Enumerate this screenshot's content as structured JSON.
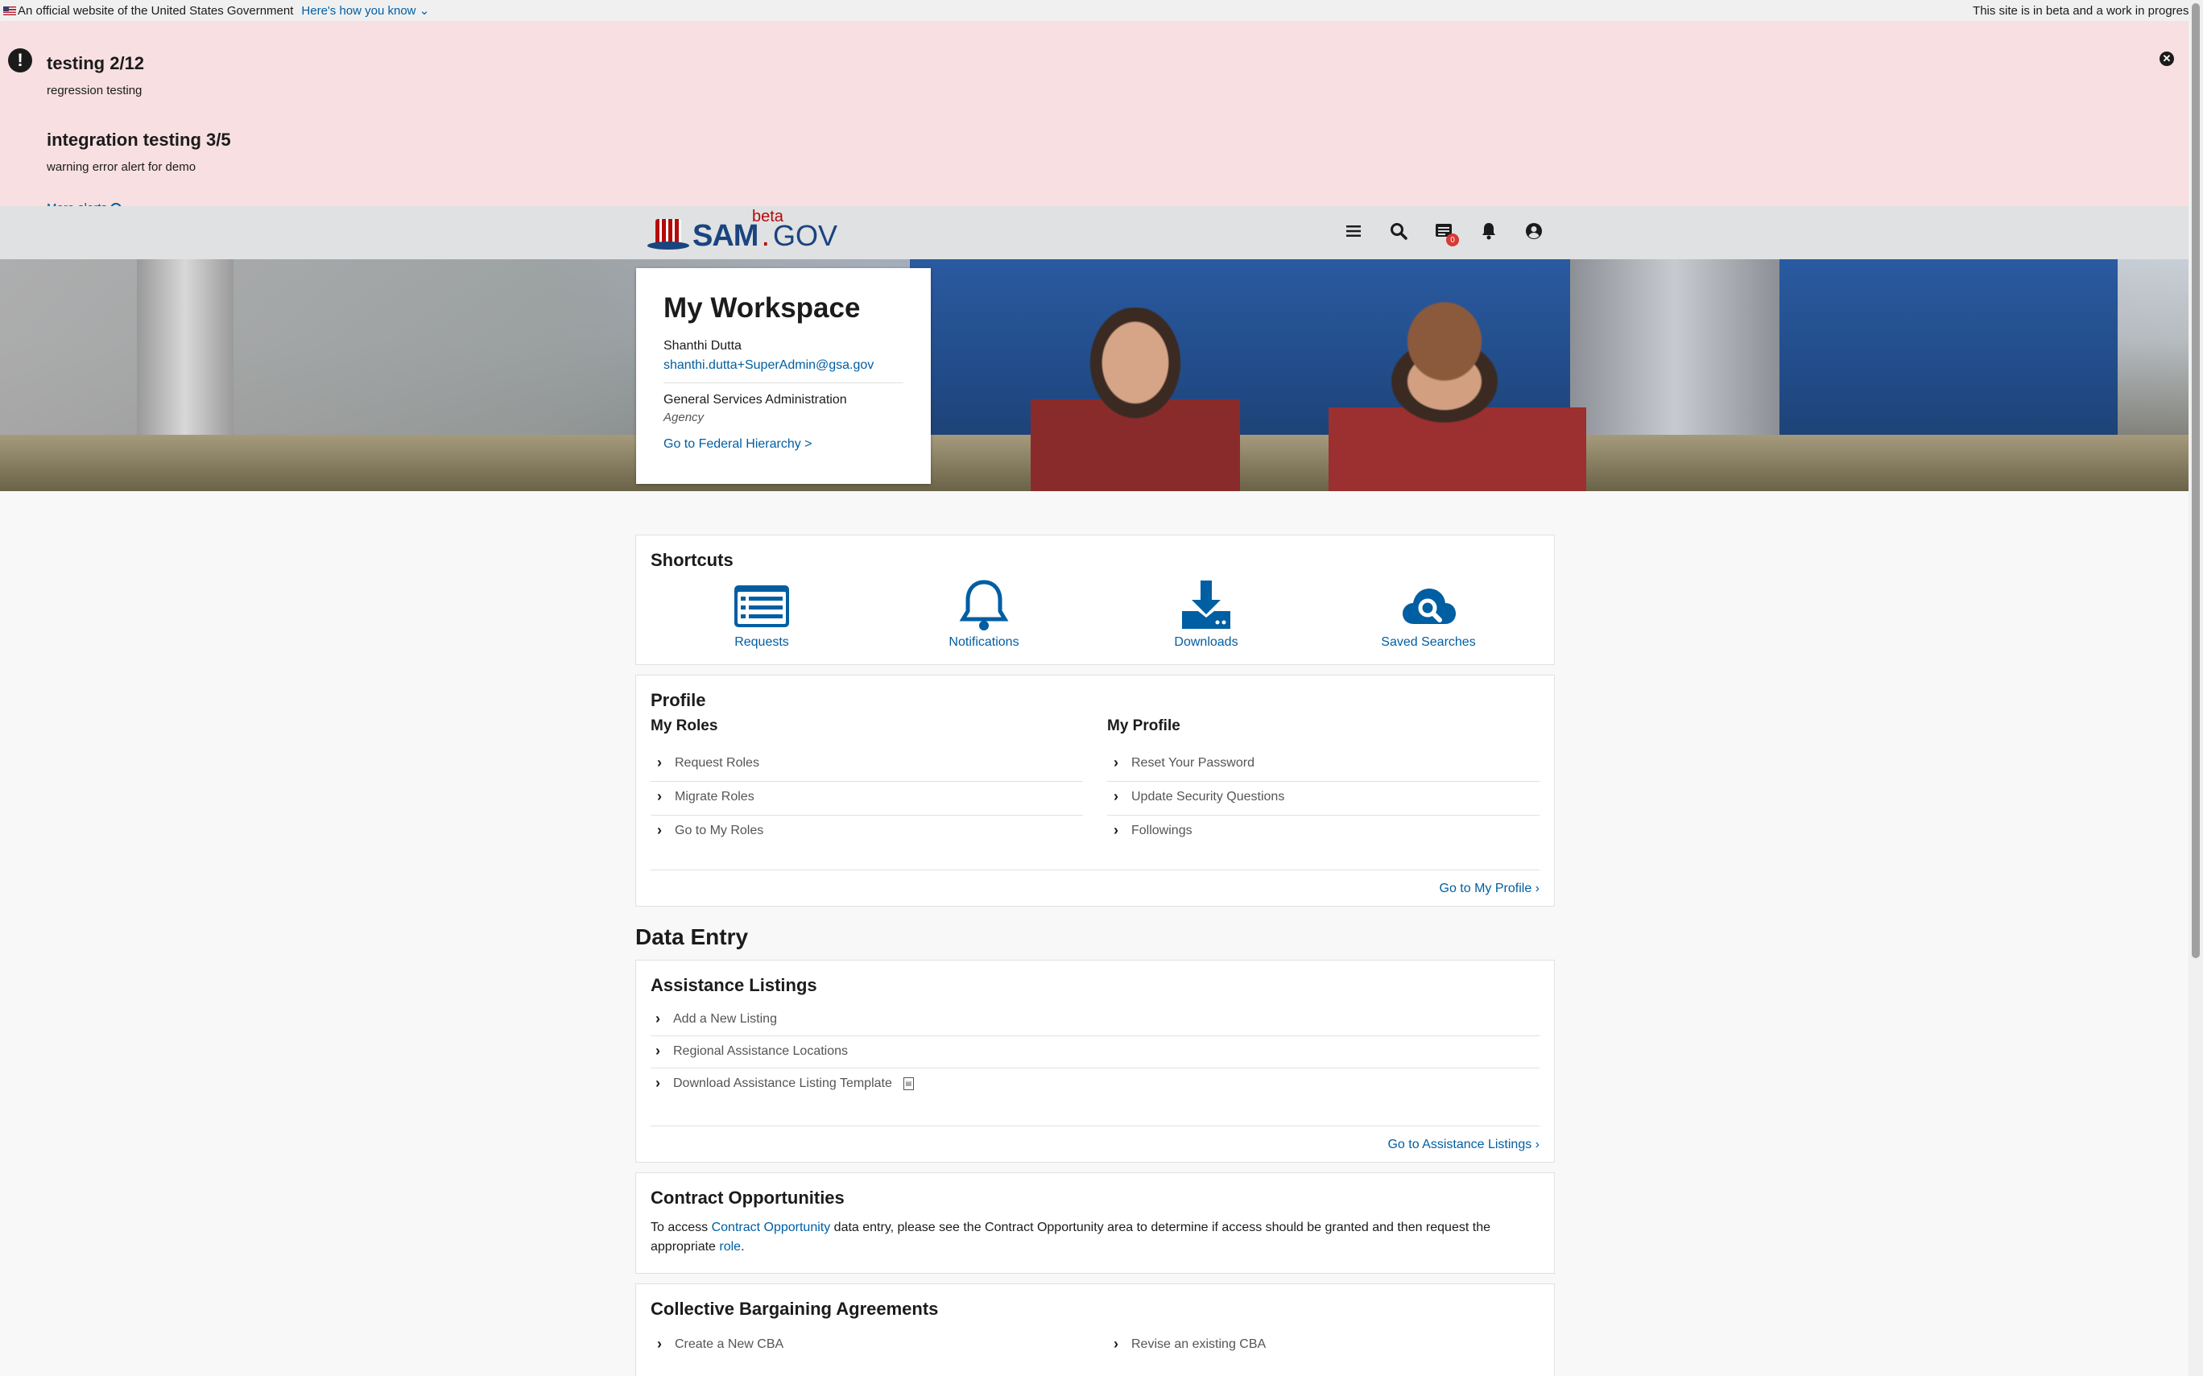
{
  "gov_banner": {
    "official_text": "An official website of the United States Government",
    "how_you_know": "Here's how you know",
    "beta_notice": "This site is in beta and a work in progress"
  },
  "alerts": {
    "items": [
      {
        "title": "testing 2/12",
        "body": "regression testing"
      },
      {
        "title": "integration testing 3/5",
        "body": "warning error alert for demo"
      }
    ],
    "more_label": "More alerts"
  },
  "header": {
    "logo_sam": "SAM",
    "logo_gov": "GOV",
    "logo_beta": "beta",
    "messages_badge": "0"
  },
  "workspace": {
    "title": "My Workspace",
    "user_name": "Shanthi Dutta",
    "user_email": "shanthi.dutta+SuperAdmin@gsa.gov",
    "org_name": "General Services Administration",
    "org_type": "Agency",
    "hierarchy_link": "Go to Federal Hierarchy >"
  },
  "shortcuts": {
    "title": "Shortcuts",
    "items": [
      {
        "label": "Requests",
        "icon": "list-icon"
      },
      {
        "label": "Notifications",
        "icon": "bell-icon"
      },
      {
        "label": "Downloads",
        "icon": "download-icon"
      },
      {
        "label": "Saved Searches",
        "icon": "cloud-search-icon"
      }
    ]
  },
  "profile": {
    "title": "Profile",
    "roles_title": "My Roles",
    "roles": [
      "Request Roles",
      "Migrate Roles",
      "Go to My Roles"
    ],
    "my_profile_title": "My Profile",
    "my_profile": [
      "Reset Your Password",
      "Update Security Questions",
      "Followings"
    ],
    "footer_link": "Go to My Profile"
  },
  "data_entry": {
    "title": "Data Entry",
    "assistance": {
      "title": "Assistance Listings",
      "links": [
        "Add a New Listing",
        "Regional Assistance Locations",
        "Download Assistance Listing Template"
      ],
      "footer_link": "Go to Assistance Listings"
    },
    "contract": {
      "title": "Contract Opportunities",
      "text_before": "To access ",
      "link1": "Contract Opportunity",
      "text_middle": " data entry, please see the Contract Opportunity area to determine if access should be granted and then request the appropriate ",
      "link2": "role",
      "text_after": "."
    },
    "cba": {
      "title": "Collective Bargaining Agreements",
      "create": "Create a New CBA",
      "revise": "Revise an existing CBA"
    }
  },
  "colors": {
    "alert_bg": "#f8dfe1",
    "link": "#005ea2",
    "brand_blue": "#1a4480",
    "brand_red": "#b50909"
  }
}
